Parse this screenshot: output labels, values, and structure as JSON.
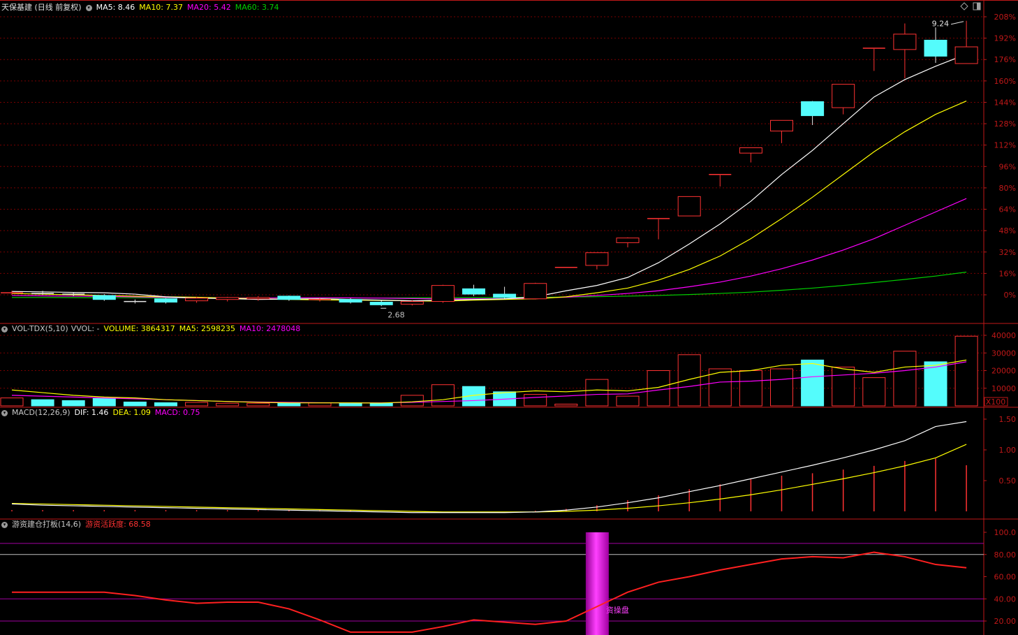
{
  "colors": {
    "up": "#ff3232",
    "down": "#54fcfc",
    "grid": "#7a0000",
    "axis": "#c01818",
    "ma5": "#ffffff",
    "ma10": "#ffff00",
    "ma20": "#ff00ff",
    "ma60": "#00d000",
    "macd_bar": "#ff3232",
    "vol_ma5": "#ffff00",
    "vol_ma10": "#ff00ff",
    "act_line": "#ff2020",
    "act_bar": "#e000e0"
  },
  "price_panel": {
    "header": {
      "title": "天保基建 (日线 前复权)",
      "ma5": "MA5: 8.46",
      "ma10": "MA10: 7.37",
      "ma20": "MA20: 5.42",
      "ma60": "MA60: 3.74"
    },
    "y_ticks": [
      "208%",
      "192%",
      "176%",
      "160%",
      "144%",
      "128%",
      "112%",
      "96%",
      "80%",
      "64%",
      "48%",
      "32%",
      "16%",
      "0%"
    ],
    "high_label": "9.24",
    "low_label": "2.68",
    "candles": [
      {
        "o": 1.0,
        "c": 1.5,
        "h": 3.0,
        "l": 0.0
      },
      {
        "o": 1.0,
        "c": 0.5,
        "h": 3.0,
        "l": 0.0
      },
      {
        "o": 0.5,
        "c": 0.2,
        "h": 2.0,
        "l": -1.0
      },
      {
        "o": -0.5,
        "c": -3.5,
        "h": 0.5,
        "l": -4.5
      },
      {
        "o": -5.0,
        "c": -5.5,
        "h": -3.5,
        "l": -6.5
      },
      {
        "o": -3.0,
        "c": -5.5,
        "h": -2.5,
        "l": -6.5
      },
      {
        "o": -4.5,
        "c": -2.5,
        "h": -1.5,
        "l": -6.0
      },
      {
        "o": -3.5,
        "c": -2.0,
        "h": -1.5,
        "l": -5.0
      },
      {
        "o": -3.0,
        "c": -2.0,
        "h": -1.0,
        "l": -4.5
      },
      {
        "o": -1.0,
        "c": -3.5,
        "h": -0.5,
        "l": -4.5
      },
      {
        "o": -4.0,
        "c": -3.5,
        "h": -2.5,
        "l": -5.0
      },
      {
        "o": -3.5,
        "c": -5.5,
        "h": -2.5,
        "l": -6.5
      },
      {
        "o": -5.5,
        "c": -7.5,
        "h": -4.0,
        "l": -8.5
      },
      {
        "o": -7.0,
        "c": -5.0,
        "h": -4.0,
        "l": -8.0
      },
      {
        "o": -5.0,
        "c": 7.0,
        "h": 7.5,
        "l": -6.0
      },
      {
        "o": 4.5,
        "c": 0.5,
        "h": 7.5,
        "l": -1.0
      },
      {
        "o": 0.5,
        "c": -2.0,
        "h": 6.0,
        "l": -3.0
      },
      {
        "o": -3.0,
        "c": 8.5,
        "h": 9.0,
        "l": -3.5
      },
      {
        "o": 20.0,
        "c": 20.5,
        "h": 20.5,
        "l": 20.0
      },
      {
        "o": 22.0,
        "c": 31.5,
        "h": 31.5,
        "l": 19.0
      },
      {
        "o": 39.0,
        "c": 42.5,
        "h": 43.0,
        "l": 35.5
      },
      {
        "o": 56.5,
        "c": 57.0,
        "h": 57.5,
        "l": 41.5
      },
      {
        "o": 59.0,
        "c": 73.5,
        "h": 73.5,
        "l": 59.0
      },
      {
        "o": 89.5,
        "c": 90.0,
        "h": 90.0,
        "l": 81.0
      },
      {
        "o": 106.0,
        "c": 110.0,
        "h": 110.0,
        "l": 99.0
      },
      {
        "o": 122.5,
        "c": 130.5,
        "h": 130.5,
        "l": 113.5
      },
      {
        "o": 144.5,
        "c": 134.0,
        "h": 145.0,
        "l": 127.0
      },
      {
        "o": 140.0,
        "c": 157.5,
        "h": 157.5,
        "l": 135.0
      },
      {
        "o": 184.0,
        "c": 184.5,
        "h": 184.5,
        "l": 167.5
      },
      {
        "o": 183.5,
        "c": 195.0,
        "h": 203.0,
        "l": 162.0
      },
      {
        "o": 190.5,
        "c": 178.5,
        "h": 200.0,
        "l": 173.5
      },
      {
        "o": 173.0,
        "c": 185.5,
        "h": 205.0,
        "l": 173.0
      }
    ],
    "ma5": [
      2.5,
      2.2,
      1.8,
      1.5,
      0.5,
      -1.5,
      -2.5,
      -2.8,
      -3.5,
      -3.2,
      -3.0,
      -3.5,
      -4.0,
      -4.5,
      -4.0,
      -3.5,
      -3.0,
      -1.5,
      3.0,
      7.0,
      13.0,
      24.0,
      38.0,
      53.0,
      70.0,
      90.0,
      108.0,
      128.0,
      148.0,
      161.0,
      171.0,
      180.0
    ],
    "ma10": [
      1.0,
      0.5,
      0.0,
      -0.5,
      -1.0,
      -1.5,
      -1.8,
      -2.5,
      -3.0,
      -3.5,
      -3.8,
      -4.0,
      -4.2,
      -4.5,
      -4.8,
      -4.0,
      -3.5,
      -3.0,
      -1.5,
      1.5,
      5.0,
      11.0,
      19.0,
      29.0,
      42.0,
      57.0,
      73.0,
      90.0,
      107.0,
      122.0,
      135.0,
      145.0
    ],
    "ma20": [
      -0.5,
      -0.8,
      -1.0,
      -1.2,
      -1.5,
      -2.0,
      -2.3,
      -2.5,
      -2.5,
      -2.3,
      -2.2,
      -2.3,
      -2.5,
      -2.8,
      -3.0,
      -3.0,
      -3.0,
      -2.5,
      -1.8,
      -0.5,
      1.0,
      3.0,
      6.0,
      9.5,
      14.0,
      19.5,
      26.0,
      33.5,
      42.0,
      52.0,
      62.0,
      72.0
    ],
    "ma60": [
      -2.0,
      -2.0,
      -2.1,
      -2.2,
      -2.2,
      -2.3,
      -2.3,
      -2.4,
      -2.4,
      -2.4,
      -2.4,
      -2.4,
      -2.4,
      -2.3,
      -2.2,
      -2.1,
      -2.0,
      -1.9,
      -1.7,
      -1.4,
      -1.0,
      -0.5,
      0.2,
      1.0,
      2.0,
      3.4,
      5.0,
      7.0,
      9.2,
      11.5,
      14.0,
      17.0
    ]
  },
  "vol_panel": {
    "header": {
      "name": "VOL-TDX(5,10)",
      "vvol": "VVOL: -",
      "volume": "VOLUME: 3864317",
      "ma5": "MA5: 2598235",
      "ma10": "MA10: 2478048"
    },
    "y_ticks": [
      "40000",
      "30000",
      "20000",
      "10000"
    ],
    "unit": "X100",
    "values": [
      4500,
      3500,
      3000,
      4200,
      2200,
      1800,
      2000,
      1500,
      1500,
      1800,
      1700,
      1500,
      1400,
      6000,
      12000,
      11000,
      8000,
      6500,
      1000,
      15000,
      5500,
      20000,
      29000,
      21000,
      20000,
      21000,
      26000,
      22000,
      16000,
      31000,
      25000,
      39500
    ],
    "ma5": [
      9000,
      7500,
      6000,
      5000,
      4500,
      3500,
      3000,
      2500,
      2000,
      1700,
      1700,
      1700,
      1600,
      2300,
      3500,
      6000,
      7500,
      8500,
      8000,
      9000,
      8500,
      10500,
      15000,
      19000,
      20000,
      23000,
      24000,
      21000,
      19000,
      22000,
      23000,
      26000
    ],
    "ma10": [
      6000,
      5500,
      5000,
      4500,
      4000,
      3500,
      3000,
      2500,
      2200,
      2000,
      1800,
      1700,
      1700,
      2000,
      2500,
      3000,
      3800,
      4800,
      5600,
      6500,
      6800,
      9000,
      11000,
      13500,
      14000,
      15000,
      16500,
      17500,
      18500,
      20000,
      22000,
      25000
    ]
  },
  "macd_panel": {
    "header": {
      "name": "MACD(12,26,9)",
      "dif": "DIF: 1.46",
      "dea": "DEA: 1.09",
      "macd": "MACD: 0.75"
    },
    "y_ticks": [
      "1.50",
      "1.00",
      "0.50"
    ],
    "dif": [
      0.12,
      0.1,
      0.09,
      0.08,
      0.07,
      0.06,
      0.05,
      0.04,
      0.03,
      0.02,
      0.01,
      0.0,
      -0.01,
      -0.02,
      -0.02,
      -0.02,
      -0.02,
      -0.01,
      0.02,
      0.07,
      0.14,
      0.22,
      0.32,
      0.42,
      0.53,
      0.64,
      0.75,
      0.87,
      1.0,
      1.15,
      1.38,
      1.46
    ],
    "dea": [
      0.13,
      0.12,
      0.11,
      0.1,
      0.09,
      0.08,
      0.07,
      0.06,
      0.05,
      0.04,
      0.03,
      0.02,
      0.01,
      0.0,
      -0.01,
      -0.01,
      -0.01,
      -0.01,
      0.0,
      0.02,
      0.05,
      0.09,
      0.14,
      0.2,
      0.27,
      0.35,
      0.44,
      0.53,
      0.63,
      0.74,
      0.87,
      1.09
    ],
    "bars": [
      0.02,
      0.02,
      0.02,
      0.02,
      0.02,
      0.02,
      0.02,
      0.02,
      0.02,
      0.02,
      0.02,
      0.02,
      0.0,
      0.0,
      0.0,
      0.0,
      0.0,
      0.01,
      0.04,
      0.1,
      0.18,
      0.26,
      0.36,
      0.44,
      0.52,
      0.58,
      0.62,
      0.68,
      0.74,
      0.82,
      0.86,
      0.75
    ]
  },
  "activity_panel": {
    "header": {
      "name": "游资建仓打板(14,6)",
      "value": "游资活跃度: 68.58"
    },
    "y_ticks": [
      "100.0",
      "80.00",
      "60.00",
      "40.00",
      "20.00"
    ],
    "label": "资操盘",
    "bar_index": 19,
    "bar_value": 100,
    "line": [
      46,
      46,
      46,
      46,
      43,
      39,
      36,
      37,
      37,
      31,
      21,
      10,
      10,
      10,
      15,
      21,
      19,
      17,
      20,
      33,
      46,
      55,
      60,
      66,
      71,
      76,
      78,
      77,
      82,
      78,
      71,
      68
    ]
  }
}
